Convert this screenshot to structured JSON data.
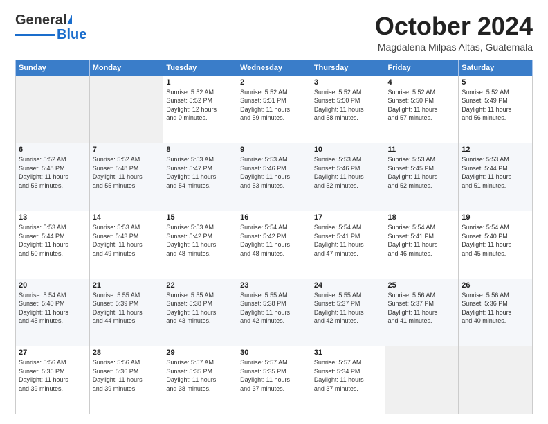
{
  "logo": {
    "general": "General",
    "blue": "Blue"
  },
  "header": {
    "month": "October 2024",
    "location": "Magdalena Milpas Altas, Guatemala"
  },
  "weekdays": [
    "Sunday",
    "Monday",
    "Tuesday",
    "Wednesday",
    "Thursday",
    "Friday",
    "Saturday"
  ],
  "weeks": [
    [
      {
        "day": "",
        "info": ""
      },
      {
        "day": "",
        "info": ""
      },
      {
        "day": "1",
        "info": "Sunrise: 5:52 AM\nSunset: 5:52 PM\nDaylight: 12 hours\nand 0 minutes."
      },
      {
        "day": "2",
        "info": "Sunrise: 5:52 AM\nSunset: 5:51 PM\nDaylight: 11 hours\nand 59 minutes."
      },
      {
        "day": "3",
        "info": "Sunrise: 5:52 AM\nSunset: 5:50 PM\nDaylight: 11 hours\nand 58 minutes."
      },
      {
        "day": "4",
        "info": "Sunrise: 5:52 AM\nSunset: 5:50 PM\nDaylight: 11 hours\nand 57 minutes."
      },
      {
        "day": "5",
        "info": "Sunrise: 5:52 AM\nSunset: 5:49 PM\nDaylight: 11 hours\nand 56 minutes."
      }
    ],
    [
      {
        "day": "6",
        "info": "Sunrise: 5:52 AM\nSunset: 5:48 PM\nDaylight: 11 hours\nand 56 minutes."
      },
      {
        "day": "7",
        "info": "Sunrise: 5:52 AM\nSunset: 5:48 PM\nDaylight: 11 hours\nand 55 minutes."
      },
      {
        "day": "8",
        "info": "Sunrise: 5:53 AM\nSunset: 5:47 PM\nDaylight: 11 hours\nand 54 minutes."
      },
      {
        "day": "9",
        "info": "Sunrise: 5:53 AM\nSunset: 5:46 PM\nDaylight: 11 hours\nand 53 minutes."
      },
      {
        "day": "10",
        "info": "Sunrise: 5:53 AM\nSunset: 5:46 PM\nDaylight: 11 hours\nand 52 minutes."
      },
      {
        "day": "11",
        "info": "Sunrise: 5:53 AM\nSunset: 5:45 PM\nDaylight: 11 hours\nand 52 minutes."
      },
      {
        "day": "12",
        "info": "Sunrise: 5:53 AM\nSunset: 5:44 PM\nDaylight: 11 hours\nand 51 minutes."
      }
    ],
    [
      {
        "day": "13",
        "info": "Sunrise: 5:53 AM\nSunset: 5:44 PM\nDaylight: 11 hours\nand 50 minutes."
      },
      {
        "day": "14",
        "info": "Sunrise: 5:53 AM\nSunset: 5:43 PM\nDaylight: 11 hours\nand 49 minutes."
      },
      {
        "day": "15",
        "info": "Sunrise: 5:53 AM\nSunset: 5:42 PM\nDaylight: 11 hours\nand 48 minutes."
      },
      {
        "day": "16",
        "info": "Sunrise: 5:54 AM\nSunset: 5:42 PM\nDaylight: 11 hours\nand 48 minutes."
      },
      {
        "day": "17",
        "info": "Sunrise: 5:54 AM\nSunset: 5:41 PM\nDaylight: 11 hours\nand 47 minutes."
      },
      {
        "day": "18",
        "info": "Sunrise: 5:54 AM\nSunset: 5:41 PM\nDaylight: 11 hours\nand 46 minutes."
      },
      {
        "day": "19",
        "info": "Sunrise: 5:54 AM\nSunset: 5:40 PM\nDaylight: 11 hours\nand 45 minutes."
      }
    ],
    [
      {
        "day": "20",
        "info": "Sunrise: 5:54 AM\nSunset: 5:40 PM\nDaylight: 11 hours\nand 45 minutes."
      },
      {
        "day": "21",
        "info": "Sunrise: 5:55 AM\nSunset: 5:39 PM\nDaylight: 11 hours\nand 44 minutes."
      },
      {
        "day": "22",
        "info": "Sunrise: 5:55 AM\nSunset: 5:38 PM\nDaylight: 11 hours\nand 43 minutes."
      },
      {
        "day": "23",
        "info": "Sunrise: 5:55 AM\nSunset: 5:38 PM\nDaylight: 11 hours\nand 42 minutes."
      },
      {
        "day": "24",
        "info": "Sunrise: 5:55 AM\nSunset: 5:37 PM\nDaylight: 11 hours\nand 42 minutes."
      },
      {
        "day": "25",
        "info": "Sunrise: 5:56 AM\nSunset: 5:37 PM\nDaylight: 11 hours\nand 41 minutes."
      },
      {
        "day": "26",
        "info": "Sunrise: 5:56 AM\nSunset: 5:36 PM\nDaylight: 11 hours\nand 40 minutes."
      }
    ],
    [
      {
        "day": "27",
        "info": "Sunrise: 5:56 AM\nSunset: 5:36 PM\nDaylight: 11 hours\nand 39 minutes."
      },
      {
        "day": "28",
        "info": "Sunrise: 5:56 AM\nSunset: 5:36 PM\nDaylight: 11 hours\nand 39 minutes."
      },
      {
        "day": "29",
        "info": "Sunrise: 5:57 AM\nSunset: 5:35 PM\nDaylight: 11 hours\nand 38 minutes."
      },
      {
        "day": "30",
        "info": "Sunrise: 5:57 AM\nSunset: 5:35 PM\nDaylight: 11 hours\nand 37 minutes."
      },
      {
        "day": "31",
        "info": "Sunrise: 5:57 AM\nSunset: 5:34 PM\nDaylight: 11 hours\nand 37 minutes."
      },
      {
        "day": "",
        "info": ""
      },
      {
        "day": "",
        "info": ""
      }
    ]
  ]
}
